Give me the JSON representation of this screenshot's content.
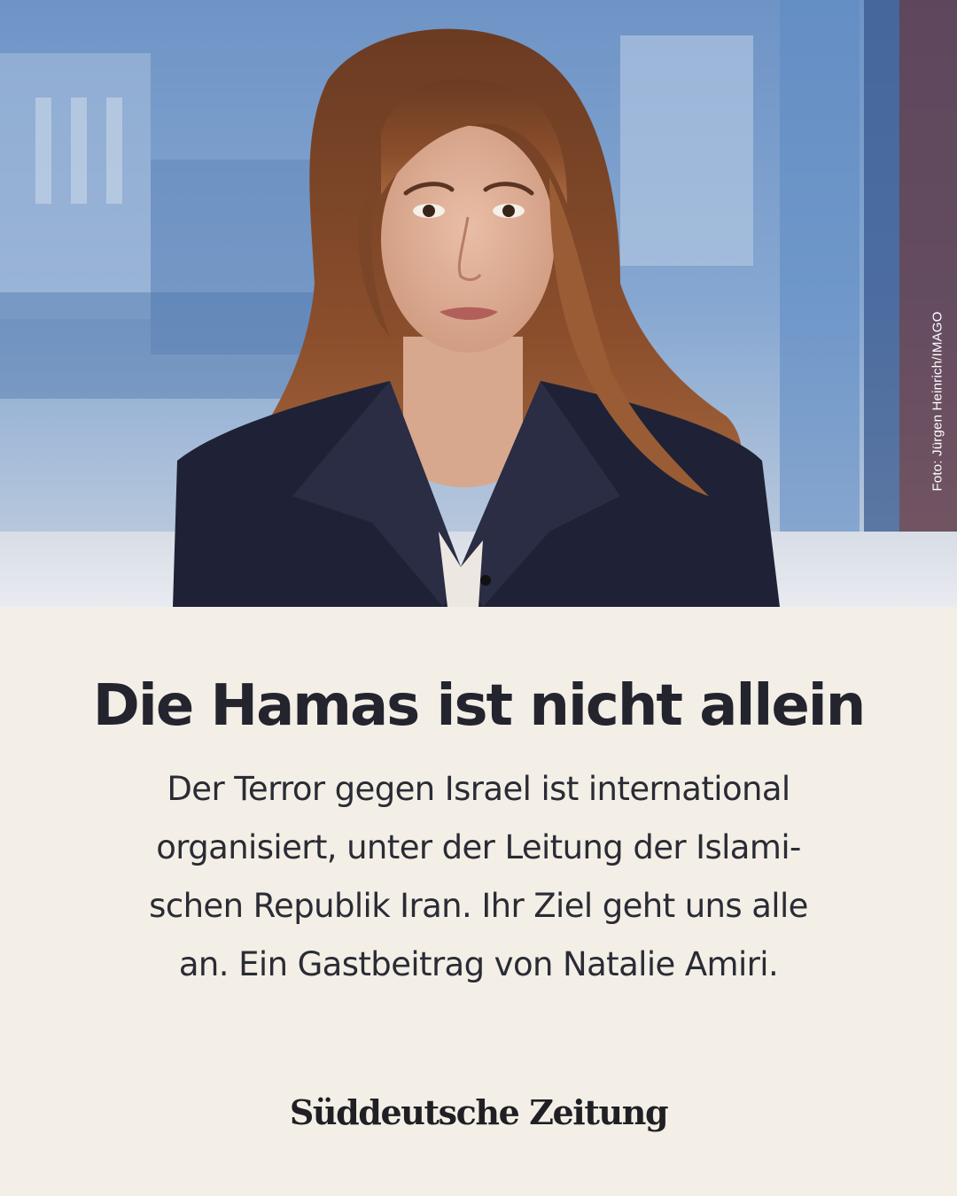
{
  "photo": {
    "credit": "Foto: Jürgen Heinrich/IMAGO"
  },
  "article": {
    "headline": "Die Hamas ist nicht allein",
    "teaser_lines": [
      "Der Terror gegen Israel ist international",
      "organisiert, unter der Leitung der Islami-",
      "schen Republik Iran. Ihr Ziel geht uns alle",
      "an. Ein Gastbeitrag von Natalie Amiri."
    ]
  },
  "brand": {
    "name": "Süddeutsche Zeitung"
  },
  "colors": {
    "background": "#f3efe6",
    "text": "#24242f",
    "photo_sky": "#7ea2cf"
  }
}
